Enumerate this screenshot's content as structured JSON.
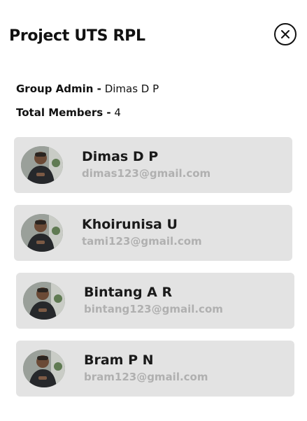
{
  "header": {
    "title": "Project UTS RPL",
    "close_icon": "close-icon"
  },
  "info": {
    "admin_label": "Group Admin -",
    "admin_value": "Dimas D P",
    "total_label": "Total Members -",
    "total_value": "4"
  },
  "members": [
    {
      "name": "Dimas D P",
      "email": "dimas123@gmail.com",
      "avatar_icon": "avatar"
    },
    {
      "name": "Khoirunisa U",
      "email": "tami123@gmail.com",
      "avatar_icon": "avatar"
    },
    {
      "name": "Bintang A R",
      "email": "bintang123@gmail.com",
      "avatar_icon": "avatar"
    },
    {
      "name": "Bram P N",
      "email": "bram123@gmail.com",
      "avatar_icon": "avatar"
    }
  ],
  "colors": {
    "card_background": "#e3e3e3",
    "email_text": "#b0b0b0",
    "title_text": "#111111"
  }
}
